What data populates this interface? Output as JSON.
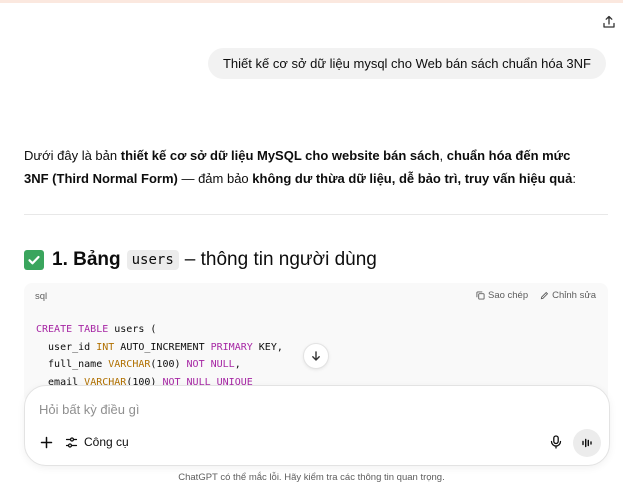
{
  "colors": {
    "accent_check": "#3aa55d",
    "keyword": "#a626a4",
    "type": "#b07000",
    "bubble": "#f2f2f2"
  },
  "user_message": "Thiết kế cơ sở dữ liệu mysql cho Web bán sách chuẩn hóa 3NF",
  "answer": {
    "intro_1": "Dưới đây là bản ",
    "intro_b1": "thiết kế cơ sở dữ liệu MySQL cho website bán sách",
    "intro_2": ", ",
    "intro_b2": "chuẩn hóa đến mức 3NF (Third Normal Form)",
    "intro_3": " — đảm bảo ",
    "intro_b3": "không dư thừa dữ liệu, dễ bảo trì, truy vấn hiệu quả",
    "intro_4": ":"
  },
  "section": {
    "icon": "check-mark-icon",
    "number": "1. Bảng",
    "table_name": "users",
    "suffix": "– thông tin người dùng"
  },
  "code": {
    "language": "sql",
    "copy_label": "Sao chép",
    "edit_label": "Chỉnh sửa",
    "line1": {
      "kw1": "CREATE TABLE",
      "rest": " users ("
    },
    "line2": {
      "col": "  user_id ",
      "type": "INT",
      "mid": " AUTO_INCREMENT ",
      "kw": "PRIMARY",
      "end": " KEY,"
    },
    "line3": {
      "col": "  full_name ",
      "type": "VARCHAR",
      "mid": "(100) ",
      "kw": "NOT NULL",
      "end": ","
    },
    "line4": {
      "col": "  email ",
      "type": "VARCHAR",
      "mid": "(100) ",
      "kw": "NOT NULL UNIQUE",
      "end": ""
    }
  },
  "composer": {
    "placeholder": "Hỏi bất kỳ điều gì",
    "tools_label": "Công cụ"
  },
  "disclaimer": "ChatGPT có thể mắc lỗi. Hãy kiểm tra các thông tin quan trọng."
}
